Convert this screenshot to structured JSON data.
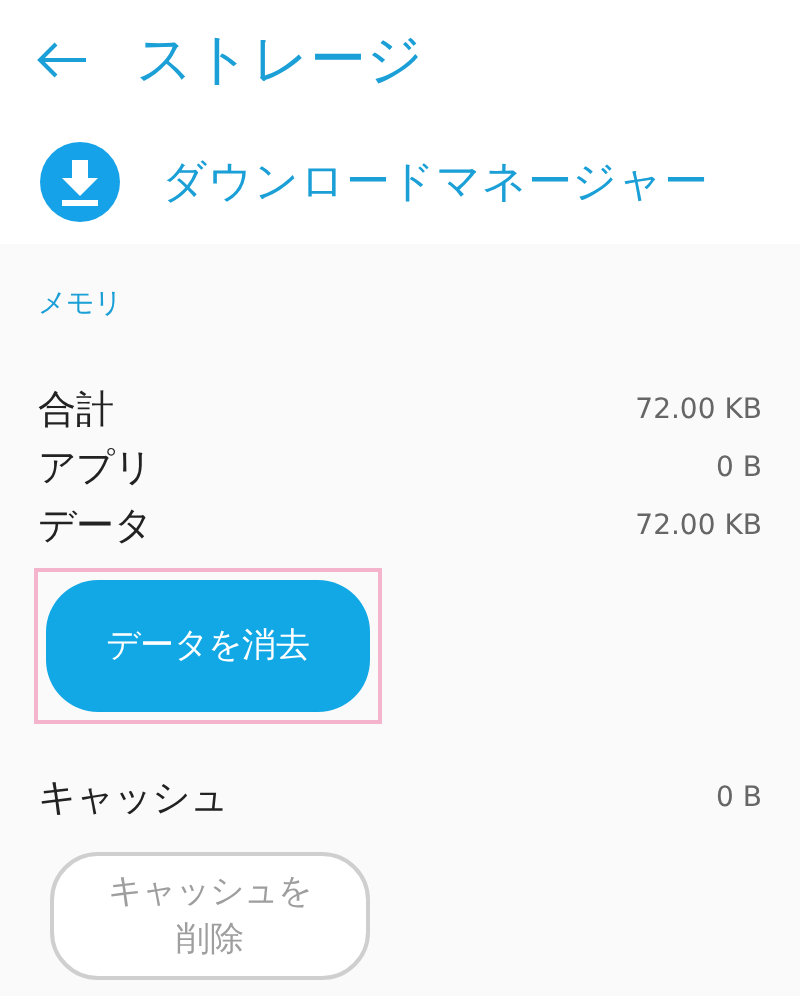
{
  "header": {
    "title": "ストレージ"
  },
  "app": {
    "name": "ダウンロードマネージャー"
  },
  "memory": {
    "heading": "メモリ",
    "rows": [
      {
        "label": "合計",
        "value": "72.00 KB"
      },
      {
        "label": "アプリ",
        "value": "0 B"
      },
      {
        "label": "データ",
        "value": "72.00 KB"
      }
    ],
    "button": {
      "label": "データを消去",
      "disabled": false,
      "highlighted": true
    }
  },
  "cache": {
    "label": "キャッシュ",
    "value": "0 B",
    "button": {
      "label": "キャッシュを削除",
      "disabled": true,
      "highlighted": false
    }
  }
}
